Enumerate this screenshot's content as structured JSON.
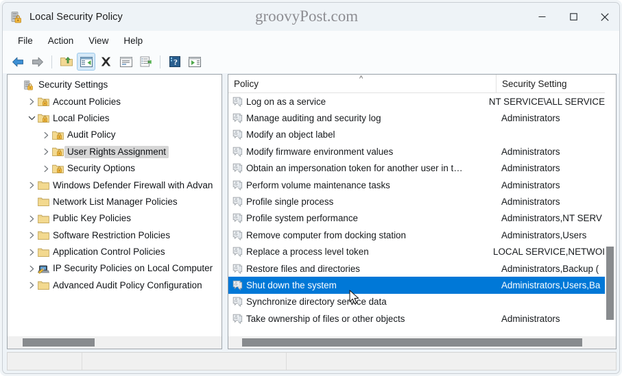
{
  "window": {
    "title": "Local Security Policy",
    "icon": "security-policy-icon",
    "watermark": "groovyPost.com",
    "controls": {
      "minimize": "—",
      "maximize": "☐",
      "close": "✕"
    }
  },
  "menubar": {
    "items": [
      "File",
      "Action",
      "View",
      "Help"
    ]
  },
  "toolbar": {
    "buttons": [
      {
        "name": "back-icon",
        "kind": "arrow-left"
      },
      {
        "name": "forward-icon",
        "kind": "arrow-right"
      },
      {
        "sep": true
      },
      {
        "name": "up-one-level-icon",
        "kind": "folder-up"
      },
      {
        "name": "show-hide-console-tree-icon",
        "kind": "console-tree",
        "active": true
      },
      {
        "name": "delete-icon",
        "kind": "x-mark"
      },
      {
        "name": "properties-icon",
        "kind": "properties"
      },
      {
        "name": "export-list-icon",
        "kind": "export-list"
      },
      {
        "sep": true
      },
      {
        "name": "help-icon",
        "kind": "help"
      },
      {
        "name": "show-action-pane-icon",
        "kind": "action-pane"
      }
    ]
  },
  "tree": {
    "nodes": [
      {
        "label": "Security Settings",
        "depth": 0,
        "twisty": "",
        "icon": "security-settings-icon",
        "selected": false
      },
      {
        "label": "Account Policies",
        "depth": 1,
        "twisty": "collapsed",
        "icon": "folder-lock-icon",
        "selected": false
      },
      {
        "label": "Local Policies",
        "depth": 1,
        "twisty": "expanded",
        "icon": "folder-lock-icon",
        "selected": false
      },
      {
        "label": "Audit Policy",
        "depth": 2,
        "twisty": "collapsed",
        "icon": "folder-lock-icon",
        "selected": false
      },
      {
        "label": "User Rights Assignment",
        "depth": 2,
        "twisty": "collapsed",
        "icon": "folder-lock-icon",
        "selected": true
      },
      {
        "label": "Security Options",
        "depth": 2,
        "twisty": "collapsed",
        "icon": "folder-lock-icon",
        "selected": false
      },
      {
        "label": "Windows Defender Firewall with Advan",
        "depth": 1,
        "twisty": "collapsed",
        "icon": "folder-icon",
        "selected": false
      },
      {
        "label": "Network List Manager Policies",
        "depth": 1,
        "twisty": "",
        "icon": "folder-icon",
        "selected": false
      },
      {
        "label": "Public Key Policies",
        "depth": 1,
        "twisty": "collapsed",
        "icon": "folder-icon",
        "selected": false
      },
      {
        "label": "Software Restriction Policies",
        "depth": 1,
        "twisty": "collapsed",
        "icon": "folder-icon",
        "selected": false
      },
      {
        "label": "Application Control Policies",
        "depth": 1,
        "twisty": "collapsed",
        "icon": "folder-icon",
        "selected": false
      },
      {
        "label": "IP Security Policies on Local Computer",
        "depth": 1,
        "twisty": "collapsed",
        "icon": "ip-security-icon",
        "selected": false
      },
      {
        "label": "Advanced Audit Policy Configuration",
        "depth": 1,
        "twisty": "collapsed",
        "icon": "folder-icon",
        "selected": false
      }
    ]
  },
  "list": {
    "columns": [
      {
        "key": "policy",
        "label": "Policy",
        "sort": "ascending"
      },
      {
        "key": "setting",
        "label": "Security Setting"
      }
    ],
    "rows": [
      {
        "policy": "Log on as a service",
        "setting": "NT SERVICE\\ALL SERVICE",
        "selected": false
      },
      {
        "policy": "Manage auditing and security log",
        "setting": "Administrators",
        "selected": false
      },
      {
        "policy": "Modify an object label",
        "setting": "",
        "selected": false
      },
      {
        "policy": "Modify firmware environment values",
        "setting": "Administrators",
        "selected": false
      },
      {
        "policy": "Obtain an impersonation token for another user in t…",
        "setting": "Administrators",
        "selected": false
      },
      {
        "policy": "Perform volume maintenance tasks",
        "setting": "Administrators",
        "selected": false
      },
      {
        "policy": "Profile single process",
        "setting": "Administrators",
        "selected": false
      },
      {
        "policy": "Profile system performance",
        "setting": "Administrators,NT SERV",
        "selected": false
      },
      {
        "policy": "Remove computer from docking station",
        "setting": "Administrators,Users",
        "selected": false
      },
      {
        "policy": "Replace a process level token",
        "setting": "LOCAL SERVICE,NETWOI",
        "selected": false
      },
      {
        "policy": "Restore files and directories",
        "setting": "Administrators,Backup (",
        "selected": false
      },
      {
        "policy": "Shut down the system",
        "setting": "Administrators,Users,Ba",
        "selected": true
      },
      {
        "policy": "Synchronize directory service data",
        "setting": "",
        "selected": false
      },
      {
        "policy": "Take ownership of files or other objects",
        "setting": "Administrators",
        "selected": false
      }
    ]
  },
  "statusbar": {
    "segments": [
      "",
      "",
      ""
    ]
  },
  "colors": {
    "selection_blue": "#0078d7",
    "tree_selection_gray": "#d6d6d6",
    "titlebar_bg": "#eef3f7",
    "toolbar_bg": "#fafcfd",
    "scrollbar_thumb": "#888b8e",
    "folder_yellow": "#f5d17a",
    "padlock_gold": "#e8a33d"
  }
}
